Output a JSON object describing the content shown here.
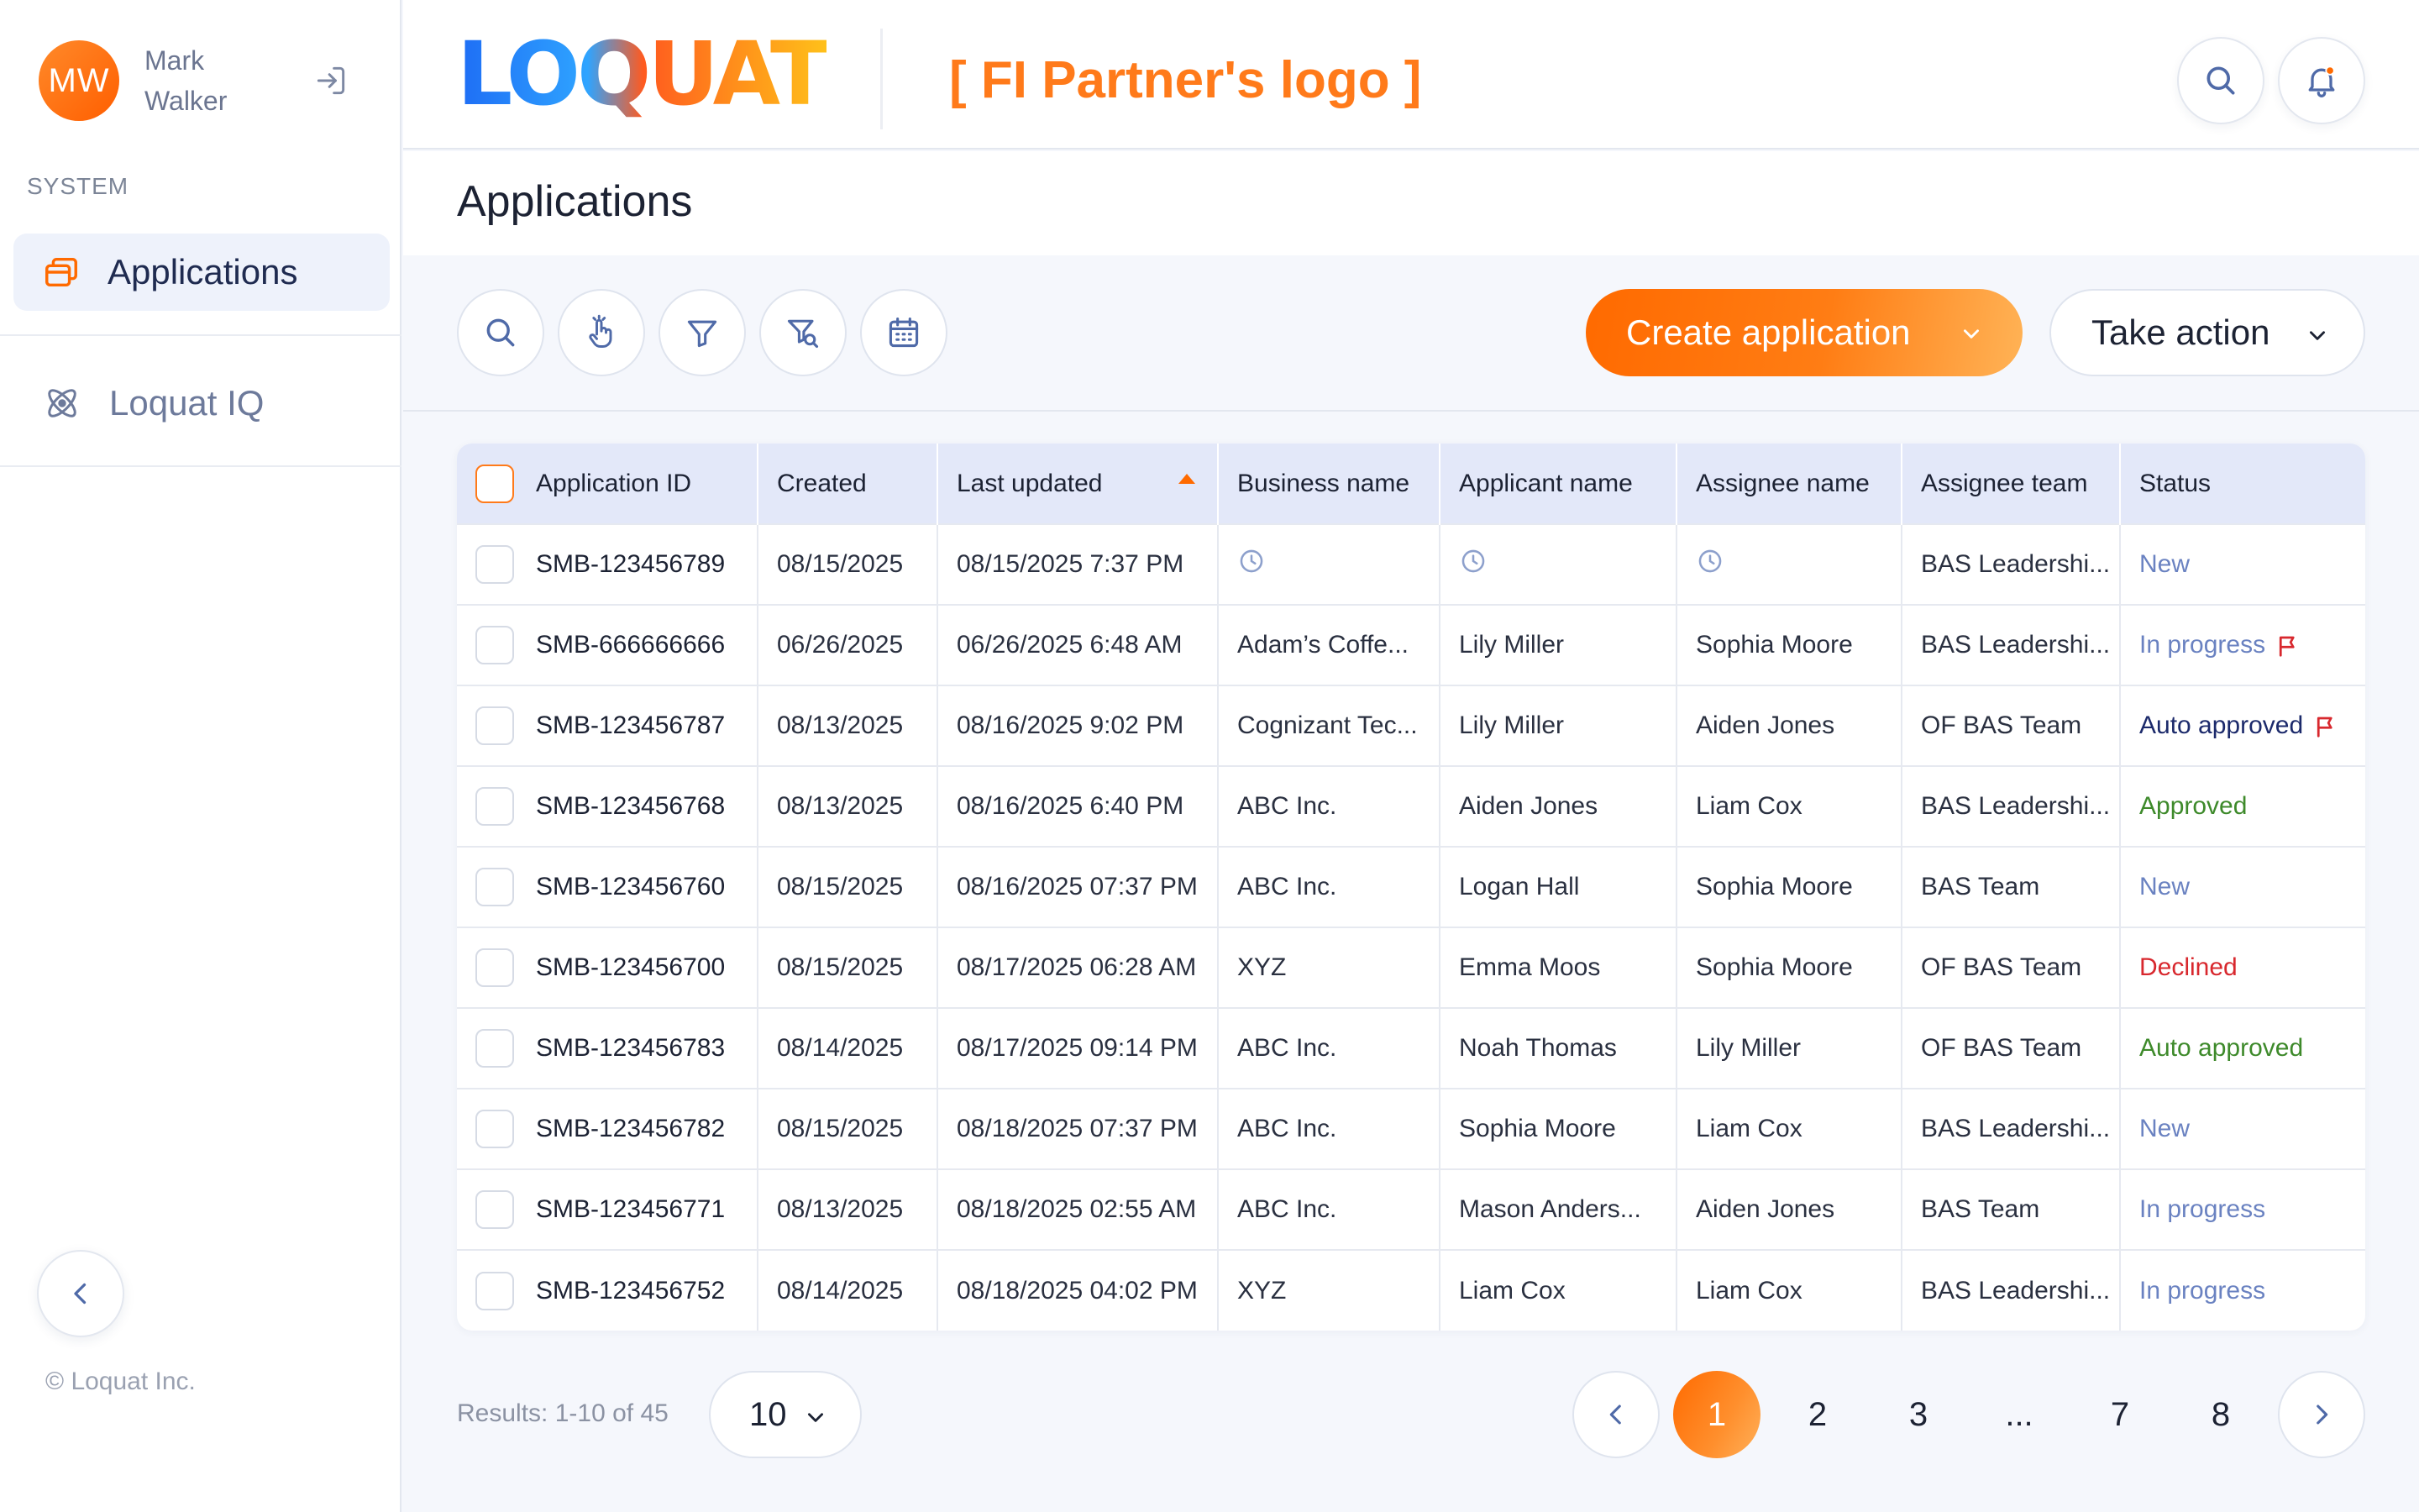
{
  "user": {
    "initials": "MW",
    "name": "Mark Walker"
  },
  "sidebar": {
    "section_label": "SYSTEM",
    "items": [
      {
        "label": "Applications",
        "icon": "applications-icon",
        "active": true
      },
      {
        "label": "Loquat IQ",
        "icon": "atom-icon",
        "active": false
      }
    ],
    "copyright": "© Loquat Inc."
  },
  "header": {
    "logo_text": "LOQUAT",
    "partner_logo": "[ FI Partner's logo ]",
    "icons": [
      "search-icon",
      "bell-icon"
    ]
  },
  "page": {
    "title": "Applications"
  },
  "toolbar": {
    "icons": [
      "search-icon",
      "pointer-icon",
      "filter-icon",
      "filter-search-icon",
      "calendar-icon"
    ],
    "create_label": "Create application",
    "action_label": "Take action"
  },
  "table": {
    "columns": [
      "Application ID",
      "Created",
      "Last updated",
      "Business name",
      "Applicant name",
      "Assignee name",
      "Assignee team",
      "Status"
    ],
    "sorted_column": "Last updated",
    "rows": [
      {
        "id": "SMB-123456789",
        "created": "08/15/2025",
        "updated": "08/15/2025 7:37 PM",
        "business": "",
        "applicant": "",
        "assignee": "",
        "team": "BAS Leadershi...",
        "status": "New",
        "status_kind": "new",
        "pending": true,
        "flag": false
      },
      {
        "id": "SMB-666666666",
        "created": "06/26/2025",
        "updated": "06/26/2025 6:48 AM",
        "business": "Adam’s Coffe...",
        "applicant": "Lily Miller",
        "assignee": "Sophia Moore",
        "team": "BAS Leadershi...",
        "status": "In progress",
        "status_kind": "inprogress",
        "pending": false,
        "flag": true
      },
      {
        "id": "SMB-123456787",
        "created": "08/13/2025",
        "updated": "08/16/2025 9:02 PM",
        "business": "Cognizant Tec...",
        "applicant": "Lily Miller",
        "assignee": "Aiden Jones",
        "team": "OF BAS Team",
        "status": "Auto approved",
        "status_kind": "auto",
        "pending": false,
        "flag": true
      },
      {
        "id": "SMB-123456768",
        "created": "08/13/2025",
        "updated": "08/16/2025 6:40 PM",
        "business": "ABC Inc.",
        "applicant": "Aiden Jones",
        "assignee": "Liam Cox",
        "team": "BAS Leadershi...",
        "status": "Approved",
        "status_kind": "approved",
        "pending": false,
        "flag": false
      },
      {
        "id": "SMB-123456760",
        "created": "08/15/2025",
        "updated": "08/16/2025 07:37 PM",
        "business": "ABC Inc.",
        "applicant": "Logan Hall",
        "assignee": "Sophia Moore",
        "team": "BAS Team",
        "status": "New",
        "status_kind": "new",
        "pending": false,
        "flag": false
      },
      {
        "id": "SMB-123456700",
        "created": "08/15/2025",
        "updated": "08/17/2025 06:28 AM",
        "business": "XYZ",
        "applicant": "Emma Moos",
        "assignee": "Sophia Moore",
        "team": "OF BAS Team",
        "status": "Declined",
        "status_kind": "declined",
        "pending": false,
        "flag": false
      },
      {
        "id": "SMB-123456783",
        "created": "08/14/2025",
        "updated": "08/17/2025 09:14 PM",
        "business": "ABC Inc.",
        "applicant": "Noah Thomas",
        "assignee": "Lily Miller",
        "team": "OF BAS Team",
        "status": "Auto approved",
        "status_kind": "approved",
        "pending": false,
        "flag": false
      },
      {
        "id": "SMB-123456782",
        "created": "08/15/2025",
        "updated": "08/18/2025 07:37 PM",
        "business": "ABC Inc.",
        "applicant": "Sophia Moore",
        "assignee": "Liam Cox",
        "team": "BAS Leadershi...",
        "status": "New",
        "status_kind": "new",
        "pending": false,
        "flag": false
      },
      {
        "id": "SMB-123456771",
        "created": "08/13/2025",
        "updated": "08/18/2025 02:55 AM",
        "business": "ABC Inc.",
        "applicant": "Mason Anders...",
        "assignee": "Aiden Jones",
        "team": "BAS Team",
        "status": "In progress",
        "status_kind": "inprogress",
        "pending": false,
        "flag": false
      },
      {
        "id": "SMB-123456752",
        "created": "08/14/2025",
        "updated": "08/18/2025 04:02 PM",
        "business": "XYZ",
        "applicant": "Liam Cox",
        "assignee": "Liam Cox",
        "team": "BAS Leadershi...",
        "status": "In progress",
        "status_kind": "inprogress",
        "pending": false,
        "flag": false
      }
    ]
  },
  "pagination": {
    "results_text": "Results: 1-10 of 45",
    "per_page": "10",
    "pages": [
      "1",
      "2",
      "3",
      "...",
      "7",
      "8"
    ],
    "current": "1"
  },
  "colors": {
    "accent": "#ff6a00",
    "header_row": "#e3e8f9",
    "status_new": "#6a82c1",
    "status_approved": "#3e8a2b",
    "status_declined": "#d8282e",
    "flag": "#d8282e"
  }
}
